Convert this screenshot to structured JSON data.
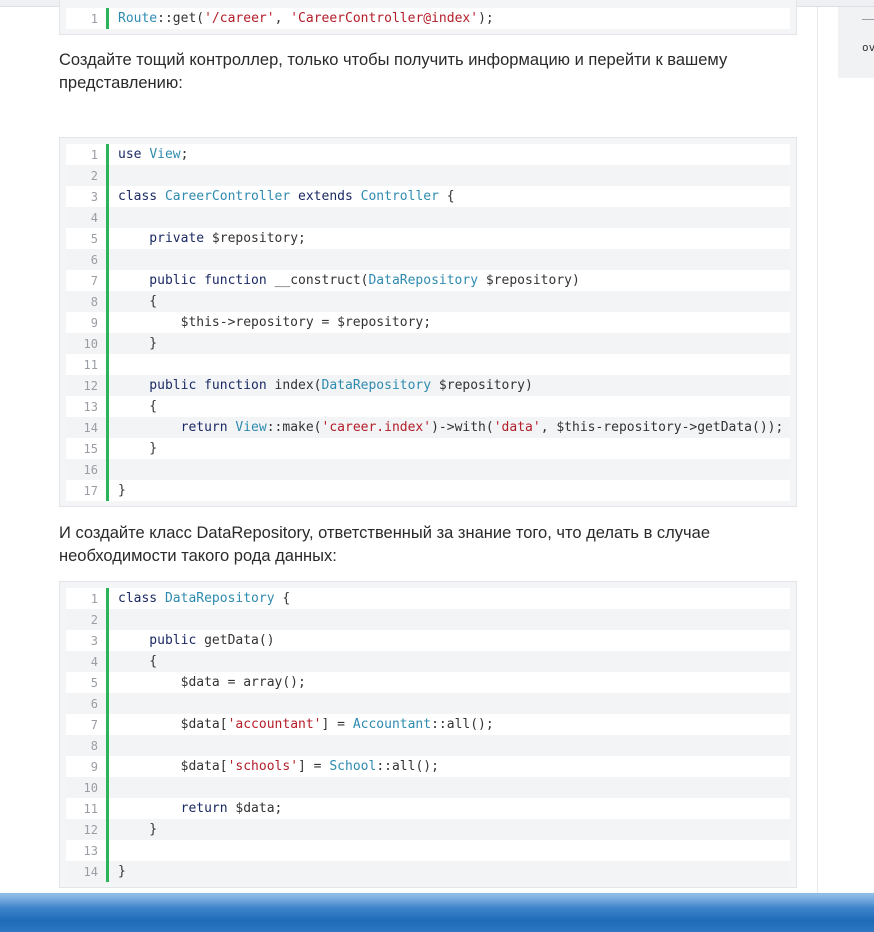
{
  "sidebar": {
    "snippet_text": "ov"
  },
  "paragraphs": {
    "p1": "Создайте тощий контроллер, только чтобы получить информацию и перейти к вашему представлению:",
    "p2": "И создайте класс DataRepository, ответственный за знание того, что делать в случае необходимости такого рода данных:"
  },
  "code_blocks": [
    {
      "lines": [
        {
          "n": "1",
          "tokens": [
            {
              "t": "Route",
              "c": "cls"
            },
            {
              "t": "::get(",
              "c": "plain"
            },
            {
              "t": "'/career'",
              "c": "str"
            },
            {
              "t": ", ",
              "c": "plain"
            },
            {
              "t": "'CareerController@index'",
              "c": "str"
            },
            {
              "t": ");",
              "c": "plain"
            }
          ]
        }
      ]
    },
    {
      "lines": [
        {
          "n": "1",
          "tokens": [
            {
              "t": "use ",
              "c": "kw"
            },
            {
              "t": "View",
              "c": "cls"
            },
            {
              "t": ";",
              "c": "plain"
            }
          ]
        },
        {
          "n": "2",
          "tokens": []
        },
        {
          "n": "3",
          "tokens": [
            {
              "t": "class ",
              "c": "kw"
            },
            {
              "t": "CareerController",
              "c": "cls"
            },
            {
              "t": " extends ",
              "c": "kw"
            },
            {
              "t": "Controller",
              "c": "cls"
            },
            {
              "t": " {",
              "c": "plain"
            }
          ]
        },
        {
          "n": "4",
          "tokens": []
        },
        {
          "n": "5",
          "tokens": [
            {
              "t": "    private ",
              "c": "kw"
            },
            {
              "t": "$repository;",
              "c": "plain"
            }
          ]
        },
        {
          "n": "6",
          "tokens": []
        },
        {
          "n": "7",
          "tokens": [
            {
              "t": "    public ",
              "c": "kw"
            },
            {
              "t": "function ",
              "c": "kw"
            },
            {
              "t": "__construct(",
              "c": "plain"
            },
            {
              "t": "DataRepository",
              "c": "cls"
            },
            {
              "t": " $repository)",
              "c": "plain"
            }
          ]
        },
        {
          "n": "8",
          "tokens": [
            {
              "t": "    {",
              "c": "plain"
            }
          ]
        },
        {
          "n": "9",
          "tokens": [
            {
              "t": "        $this->repository = $repository;",
              "c": "plain"
            }
          ]
        },
        {
          "n": "10",
          "tokens": [
            {
              "t": "    }",
              "c": "plain"
            }
          ]
        },
        {
          "n": "11",
          "tokens": []
        },
        {
          "n": "12",
          "tokens": [
            {
              "t": "    public ",
              "c": "kw"
            },
            {
              "t": "function ",
              "c": "kw"
            },
            {
              "t": "index(",
              "c": "plain"
            },
            {
              "t": "DataRepository",
              "c": "cls"
            },
            {
              "t": " $repository)",
              "c": "plain"
            }
          ]
        },
        {
          "n": "13",
          "tokens": [
            {
              "t": "    {",
              "c": "plain"
            }
          ]
        },
        {
          "n": "14",
          "tokens": [
            {
              "t": "        return ",
              "c": "kw"
            },
            {
              "t": "View",
              "c": "cls"
            },
            {
              "t": "::make(",
              "c": "plain"
            },
            {
              "t": "'career.index'",
              "c": "str"
            },
            {
              "t": ")->with(",
              "c": "plain"
            },
            {
              "t": "'data'",
              "c": "str"
            },
            {
              "t": ", $this-repository->getData());",
              "c": "plain"
            }
          ]
        },
        {
          "n": "15",
          "tokens": [
            {
              "t": "    }",
              "c": "plain"
            }
          ]
        },
        {
          "n": "16",
          "tokens": []
        },
        {
          "n": "17",
          "tokens": [
            {
              "t": "}",
              "c": "plain"
            }
          ]
        }
      ]
    },
    {
      "lines": [
        {
          "n": "1",
          "tokens": [
            {
              "t": "class ",
              "c": "kw"
            },
            {
              "t": "DataRepository",
              "c": "cls"
            },
            {
              "t": " {",
              "c": "plain"
            }
          ]
        },
        {
          "n": "2",
          "tokens": []
        },
        {
          "n": "3",
          "tokens": [
            {
              "t": "    public ",
              "c": "kw"
            },
            {
              "t": "getData()",
              "c": "plain"
            }
          ]
        },
        {
          "n": "4",
          "tokens": [
            {
              "t": "    {",
              "c": "plain"
            }
          ]
        },
        {
          "n": "5",
          "tokens": [
            {
              "t": "        $data = array();",
              "c": "plain"
            }
          ]
        },
        {
          "n": "6",
          "tokens": []
        },
        {
          "n": "7",
          "tokens": [
            {
              "t": "        $data[",
              "c": "plain"
            },
            {
              "t": "'accountant'",
              "c": "str"
            },
            {
              "t": "] = ",
              "c": "plain"
            },
            {
              "t": "Accountant",
              "c": "cls"
            },
            {
              "t": "::all();",
              "c": "plain"
            }
          ]
        },
        {
          "n": "8",
          "tokens": []
        },
        {
          "n": "9",
          "tokens": [
            {
              "t": "        $data[",
              "c": "plain"
            },
            {
              "t": "'schools'",
              "c": "str"
            },
            {
              "t": "] = ",
              "c": "plain"
            },
            {
              "t": "School",
              "c": "cls"
            },
            {
              "t": "::all();",
              "c": "plain"
            }
          ]
        },
        {
          "n": "10",
          "tokens": []
        },
        {
          "n": "11",
          "tokens": [
            {
              "t": "        return ",
              "c": "kw"
            },
            {
              "t": "$data;",
              "c": "plain"
            }
          ]
        },
        {
          "n": "12",
          "tokens": [
            {
              "t": "    }",
              "c": "plain"
            }
          ]
        },
        {
          "n": "13",
          "tokens": []
        },
        {
          "n": "14",
          "tokens": [
            {
              "t": "}",
              "c": "plain"
            }
          ]
        }
      ]
    }
  ],
  "colors": {
    "keyword": "#1b2a63",
    "class_name": "#2e8bb0",
    "string": "#b31d28",
    "gutter_accent": "#2bb45a"
  }
}
